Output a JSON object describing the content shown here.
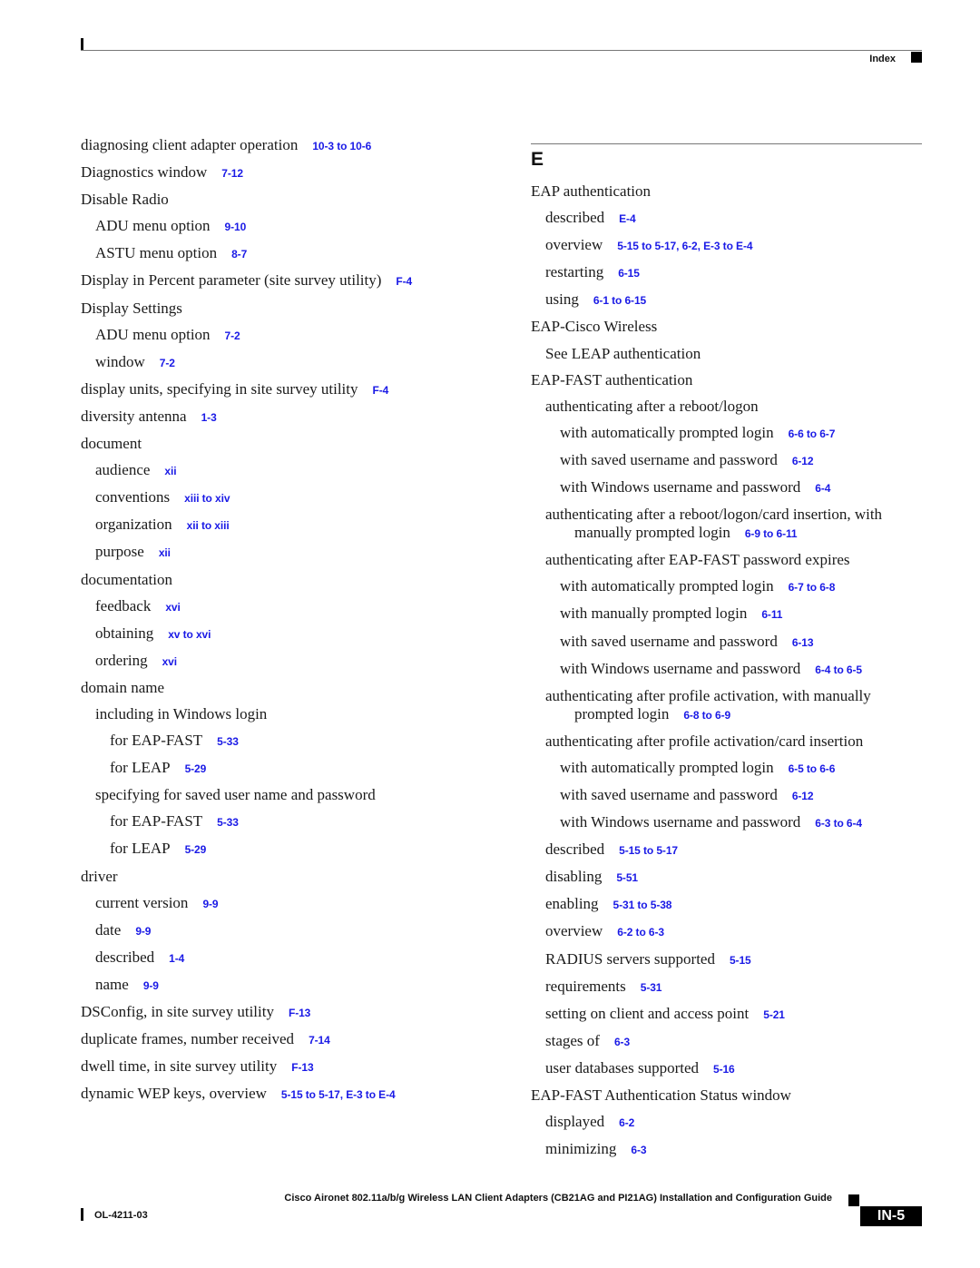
{
  "header": {
    "section_label": "Index"
  },
  "left_column": [
    {
      "level": 0,
      "text": "diagnosing client adapter operation",
      "ref": "10-3 to 10-6"
    },
    {
      "level": 0,
      "text": "Diagnostics window",
      "ref": "7-12"
    },
    {
      "level": 0,
      "text": "Disable Radio",
      "ref": ""
    },
    {
      "level": 1,
      "text": "ADU menu option",
      "ref": "9-10"
    },
    {
      "level": 1,
      "text": "ASTU menu option",
      "ref": "8-7"
    },
    {
      "level": 0,
      "text": "Display in Percent parameter (site survey utility)",
      "ref": "F-4"
    },
    {
      "level": 0,
      "text": "Display Settings",
      "ref": ""
    },
    {
      "level": 1,
      "text": "ADU menu option",
      "ref": "7-2"
    },
    {
      "level": 1,
      "text": "window",
      "ref": "7-2"
    },
    {
      "level": 0,
      "text": "display units, specifying in site survey utility",
      "ref": "F-4"
    },
    {
      "level": 0,
      "text": "diversity antenna",
      "ref": "1-3"
    },
    {
      "level": 0,
      "text": "document",
      "ref": ""
    },
    {
      "level": 1,
      "text": "audience",
      "ref": "xii"
    },
    {
      "level": 1,
      "text": "conventions",
      "ref": "xiii to xiv"
    },
    {
      "level": 1,
      "text": "organization",
      "ref": "xii to xiii"
    },
    {
      "level": 1,
      "text": "purpose",
      "ref": "xii"
    },
    {
      "level": 0,
      "text": "documentation",
      "ref": ""
    },
    {
      "level": 1,
      "text": "feedback",
      "ref": "xvi"
    },
    {
      "level": 1,
      "text": "obtaining",
      "ref": "xv to xvi"
    },
    {
      "level": 1,
      "text": "ordering",
      "ref": "xvi"
    },
    {
      "level": 0,
      "text": "domain name",
      "ref": ""
    },
    {
      "level": 1,
      "text": "including in Windows login",
      "ref": ""
    },
    {
      "level": 2,
      "text": "for EAP-FAST",
      "ref": "5-33"
    },
    {
      "level": 2,
      "text": "for LEAP",
      "ref": "5-29"
    },
    {
      "level": 1,
      "text": "specifying for saved user name and password",
      "ref": ""
    },
    {
      "level": 2,
      "text": "for EAP-FAST",
      "ref": "5-33"
    },
    {
      "level": 2,
      "text": "for LEAP",
      "ref": "5-29"
    },
    {
      "level": 0,
      "text": "driver",
      "ref": ""
    },
    {
      "level": 1,
      "text": "current version",
      "ref": "9-9"
    },
    {
      "level": 1,
      "text": "date",
      "ref": "9-9"
    },
    {
      "level": 1,
      "text": "described",
      "ref": "1-4"
    },
    {
      "level": 1,
      "text": "name",
      "ref": "9-9"
    },
    {
      "level": 0,
      "text": "DSConfig, in site survey utility",
      "ref": "F-13"
    },
    {
      "level": 0,
      "text": "duplicate frames, number received",
      "ref": "7-14"
    },
    {
      "level": 0,
      "text": "dwell time, in site survey utility",
      "ref": "F-13"
    },
    {
      "level": 0,
      "text": "dynamic WEP keys, overview",
      "ref": "5-15 to 5-17, E-3 to E-4"
    }
  ],
  "right_column": {
    "section_letter": "E",
    "entries": [
      {
        "level": 0,
        "text": "EAP authentication",
        "ref": ""
      },
      {
        "level": 1,
        "text": "described",
        "ref": "E-4"
      },
      {
        "level": 1,
        "text": "overview",
        "ref": "5-15 to 5-17, 6-2, E-3 to E-4"
      },
      {
        "level": 1,
        "text": "restarting",
        "ref": "6-15"
      },
      {
        "level": 1,
        "text": "using",
        "ref": "6-1 to 6-15"
      },
      {
        "level": 0,
        "text": "EAP-Cisco Wireless",
        "ref": ""
      },
      {
        "level": 1,
        "text": "See LEAP authentication",
        "ref": ""
      },
      {
        "level": 0,
        "text": "EAP-FAST authentication",
        "ref": ""
      },
      {
        "level": 1,
        "text": "authenticating after a reboot/logon",
        "ref": ""
      },
      {
        "level": 2,
        "text": "with automatically prompted login",
        "ref": "6-6 to 6-7"
      },
      {
        "level": 2,
        "text": "with saved username and password",
        "ref": "6-12"
      },
      {
        "level": 2,
        "text": "with Windows username and password",
        "ref": "6-4"
      },
      {
        "level": 1,
        "wrap": true,
        "text": "authenticating after a reboot/logon/card insertion, with manually prompted login",
        "ref": "6-9 to 6-11"
      },
      {
        "level": 1,
        "text": "authenticating after EAP-FAST password expires",
        "ref": ""
      },
      {
        "level": 2,
        "text": "with automatically prompted login",
        "ref": "6-7 to 6-8"
      },
      {
        "level": 2,
        "text": "with manually prompted login",
        "ref": "6-11"
      },
      {
        "level": 2,
        "text": "with saved username and password",
        "ref": "6-13"
      },
      {
        "level": 2,
        "text": "with Windows username and password",
        "ref": "6-4 to 6-5"
      },
      {
        "level": 1,
        "wrap": true,
        "text": "authenticating after profile activation, with manually prompted login",
        "ref": "6-8 to 6-9"
      },
      {
        "level": 1,
        "text": "authenticating after profile activation/card insertion",
        "ref": ""
      },
      {
        "level": 2,
        "text": "with automatically prompted login",
        "ref": "6-5 to 6-6"
      },
      {
        "level": 2,
        "text": "with saved username and password",
        "ref": "6-12"
      },
      {
        "level": 2,
        "text": "with Windows username and password",
        "ref": "6-3 to 6-4"
      },
      {
        "level": 1,
        "text": "described",
        "ref": "5-15 to 5-17"
      },
      {
        "level": 1,
        "text": "disabling",
        "ref": "5-51"
      },
      {
        "level": 1,
        "text": "enabling",
        "ref": "5-31 to 5-38"
      },
      {
        "level": 1,
        "text": "overview",
        "ref": "6-2 to 6-3"
      },
      {
        "level": 1,
        "text": "RADIUS servers supported",
        "ref": "5-15"
      },
      {
        "level": 1,
        "text": "requirements",
        "ref": "5-31"
      },
      {
        "level": 1,
        "text": "setting on client and access point",
        "ref": "5-21"
      },
      {
        "level": 1,
        "text": "stages of",
        "ref": "6-3"
      },
      {
        "level": 1,
        "text": "user databases supported",
        "ref": "5-16"
      },
      {
        "level": 0,
        "text": "EAP-FAST Authentication Status window",
        "ref": ""
      },
      {
        "level": 1,
        "text": "displayed",
        "ref": "6-2"
      },
      {
        "level": 1,
        "text": "minimizing",
        "ref": "6-3"
      }
    ]
  },
  "footer": {
    "guide_title": "Cisco Aironet 802.11a/b/g Wireless LAN Client Adapters (CB21AG and PI21AG) Installation and Configuration Guide",
    "doc_code": "OL-4211-03",
    "page_number": "IN-5"
  },
  "colors": {
    "link": "#1a1ae6",
    "text": "#1a1a1a",
    "rule": "#777777"
  }
}
